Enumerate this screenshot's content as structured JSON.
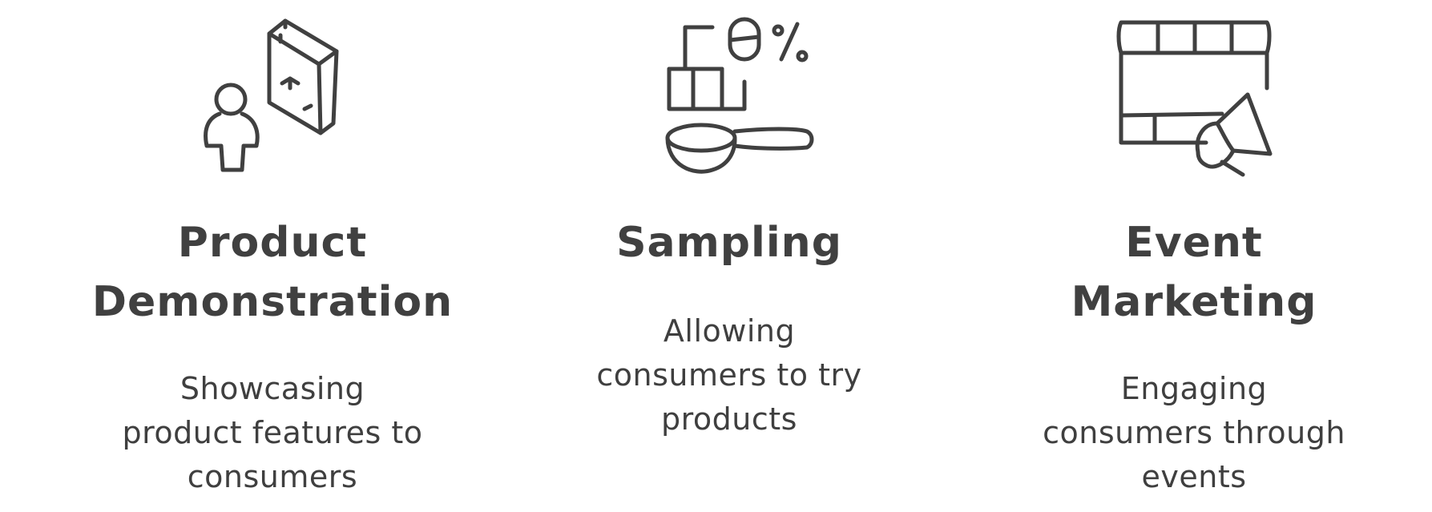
{
  "columns": [
    {
      "icon": "person-with-box-icon",
      "title_lines": [
        "Product",
        "Demonstration"
      ],
      "desc_lines": [
        "Showcasing",
        "product features to",
        "consumers"
      ]
    },
    {
      "icon": "scoop-and-blocks-icon",
      "title_lines": [
        "Sampling"
      ],
      "desc_lines": [
        "Allowing",
        "consumers to try",
        "products"
      ]
    },
    {
      "icon": "board-and-megaphone-icon",
      "title_lines": [
        "Event",
        "Marketing"
      ],
      "desc_lines": [
        "Engaging",
        "consumers through",
        "events"
      ]
    }
  ],
  "colors": {
    "ink": "#404040",
    "background": "#ffffff"
  }
}
